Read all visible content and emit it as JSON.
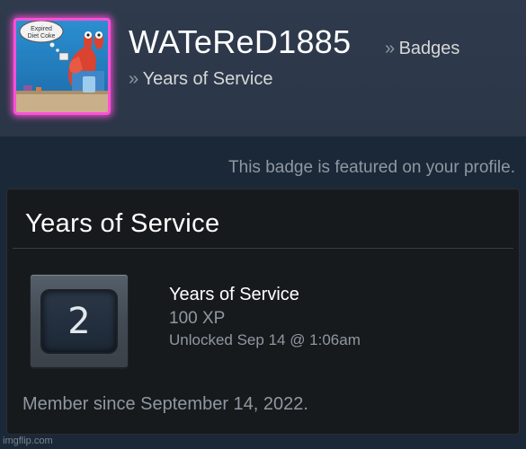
{
  "profile": {
    "persona_name": "WATeReD1885",
    "avatar_caption": "Expired Diet Coke",
    "avatar_glow_color": "#ff4fd8"
  },
  "breadcrumb": {
    "separator": "»",
    "section": "Badges",
    "current": "Years of Service"
  },
  "featured_note": "This badge is featured on your profile.",
  "badge_panel": {
    "title": "Years of Service",
    "badge": {
      "icon": "years-of-service-badge-icon",
      "level": "2",
      "name": "Years of Service",
      "xp": "100 XP",
      "unlocked": "Unlocked Sep 14 @ 1:06am"
    },
    "member_since": "Member since September 14, 2022."
  },
  "watermark": "imgflip.com",
  "colors": {
    "page_background": "#1b2838",
    "header_background": "#2f3b4d",
    "panel_background": "#171a1d",
    "muted_text": "#8f98a0",
    "primary_text": "#ffffff"
  }
}
